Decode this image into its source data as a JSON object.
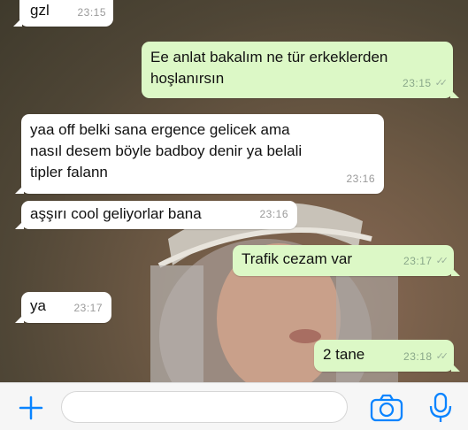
{
  "messages": [
    {
      "direction": "in",
      "text": "gzl",
      "time": "23:15"
    },
    {
      "direction": "out",
      "text_line1": "Ee anlat bakalım ne tür erkeklerden",
      "text_line2": "hoşlanırsın",
      "time": "23:15"
    },
    {
      "direction": "in",
      "text_line1": "yaa off belki sana ergence gelicek ama",
      "text_line2": "nasıl desem böyle badboy denir ya belali",
      "text_line3": "tipler falann",
      "time": "23:16"
    },
    {
      "direction": "in",
      "text": "aşşırı cool geliyorlar bana",
      "time": "23:16"
    },
    {
      "direction": "out",
      "text": "Trafik cezam var",
      "time": "23:17"
    },
    {
      "direction": "in",
      "text": "ya",
      "time": "23:17"
    },
    {
      "direction": "out",
      "text": "2 tane",
      "time": "23:18"
    }
  ],
  "input": {
    "placeholder": ""
  },
  "colors": {
    "incoming": "#ffffff",
    "outgoing": "#dcf8c6",
    "accent": "#0a84ff"
  },
  "icons": [
    "plus-icon",
    "camera-icon",
    "microphone-icon",
    "read-receipt-icon"
  ]
}
